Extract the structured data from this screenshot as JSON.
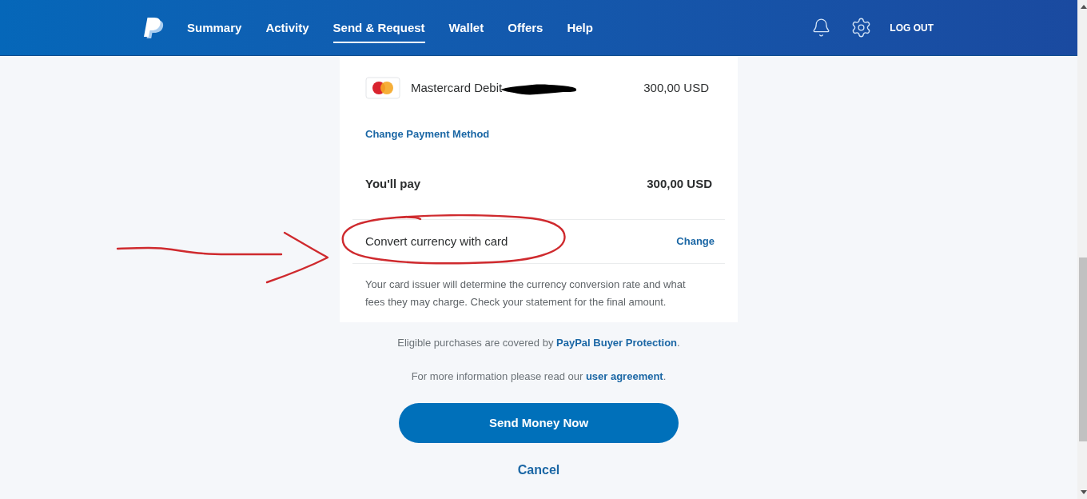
{
  "header": {
    "nav": [
      {
        "label": "Summary",
        "selected": false
      },
      {
        "label": "Activity",
        "selected": false
      },
      {
        "label": "Send & Request",
        "selected": true
      },
      {
        "label": "Wallet",
        "selected": false
      },
      {
        "label": "Offers",
        "selected": false
      },
      {
        "label": "Help",
        "selected": false
      }
    ],
    "logout": "LOG OUT"
  },
  "payment": {
    "method": {
      "name": "Mastercard Debit",
      "amount": "300,00 USD"
    },
    "change_method": "Change Payment Method",
    "total": {
      "label": "You'll pay",
      "amount": "300,00 USD"
    },
    "conversion": {
      "label": "Convert currency with card",
      "action": "Change",
      "note": "Your card issuer will determine the currency conversion rate and what fees they may charge. Check your statement for the final amount."
    }
  },
  "notices": [
    {
      "before": "Eligible purchases are covered by ",
      "link": "PayPal Buyer Protection",
      "after": "."
    },
    {
      "before": "For more information please read our ",
      "link": "user agreement",
      "after": "."
    }
  ],
  "actions": {
    "primary": "Send Money Now",
    "cancel": "Cancel"
  }
}
